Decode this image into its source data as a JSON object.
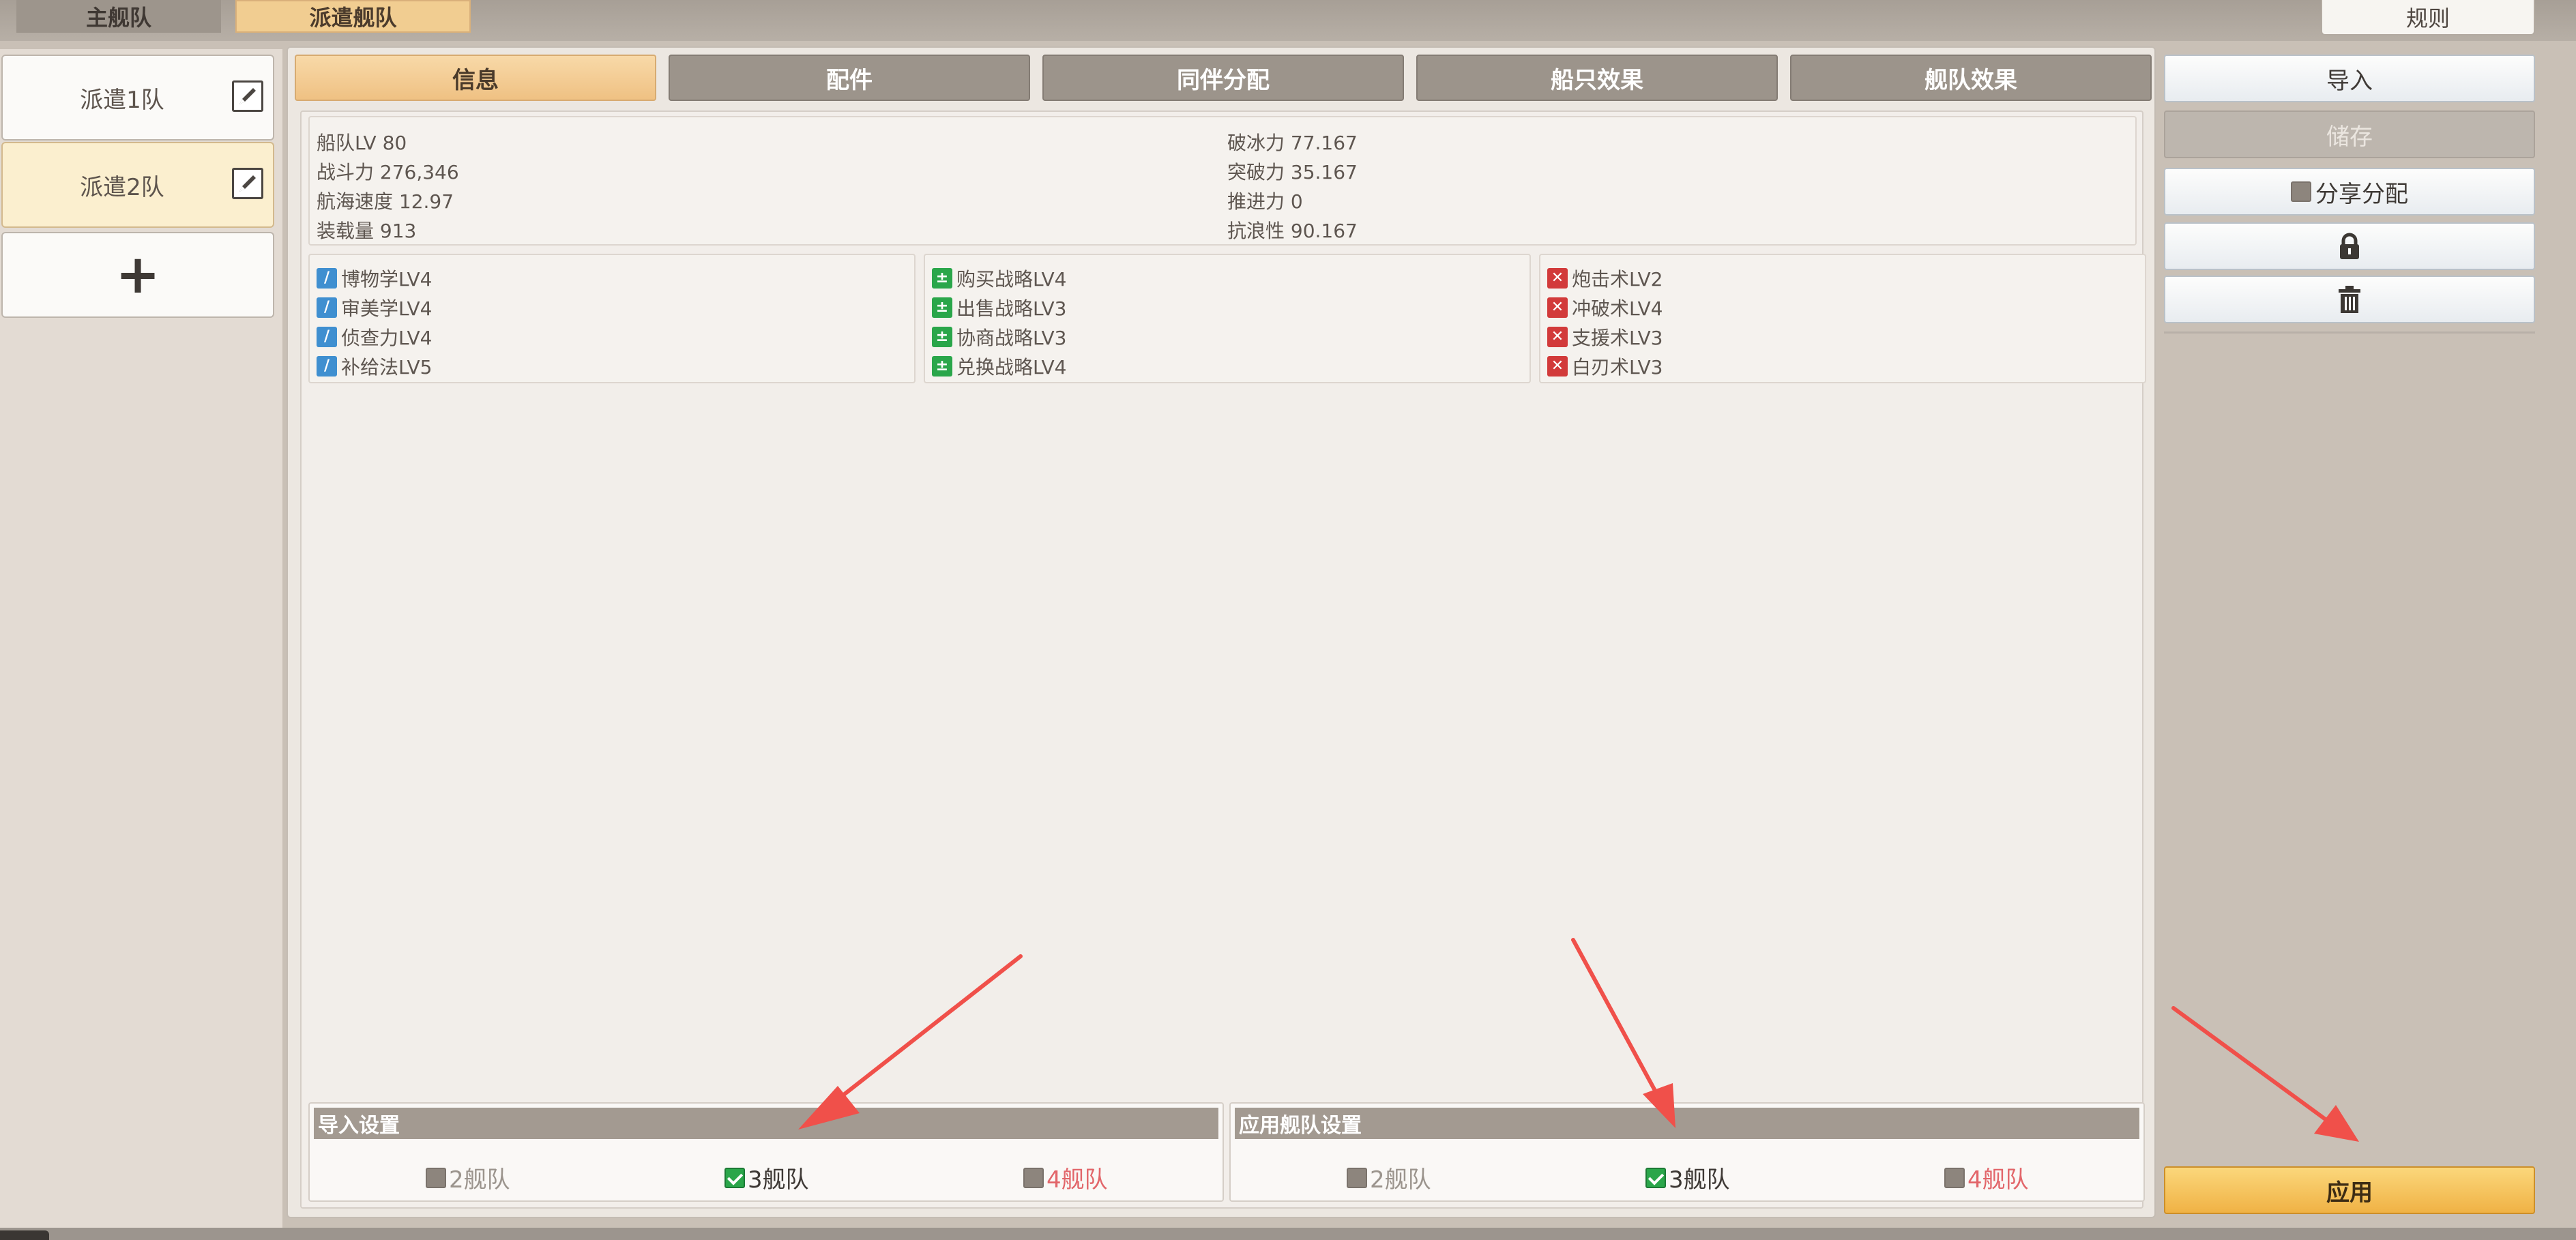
{
  "top_tabs": {
    "main": "主舰队",
    "dispatch": "派遣舰队"
  },
  "rule_button": "规则",
  "teams": [
    {
      "label": "派遣1队"
    },
    {
      "label": "派遣2队"
    }
  ],
  "tabs": [
    "信息",
    "配件",
    "同伴分配",
    "船只效果",
    "舰队效果"
  ],
  "stats": {
    "left": [
      "船队LV 80",
      "战斗力 276,346",
      "航海速度 12.97",
      "装载量 913"
    ],
    "right": [
      "破冰力 77.167",
      "突破力 35.167",
      "推进力 0",
      "抗浪性 90.167"
    ]
  },
  "skills": {
    "col1": [
      "博物学LV4",
      "审美学LV4",
      "侦查力LV4",
      "补给法LV5"
    ],
    "col2": [
      "购买战略LV4",
      "出售战略LV3",
      "协商战略LV3",
      "兑换战略LV4"
    ],
    "col3": [
      "炮击术LV2",
      "冲破术LV4",
      "支援术LV3",
      "白刃术LV3"
    ]
  },
  "icons": {
    "col1": "pen-skill-icon",
    "col2": "trade-skill-icon",
    "col3": "battle-skill-icon"
  },
  "import_settings": {
    "title": "导入设置",
    "options": [
      {
        "label": "2舰队",
        "checked": false
      },
      {
        "label": "3舰队",
        "checked": true
      },
      {
        "label": "4舰队",
        "checked": false
      }
    ]
  },
  "apply_settings": {
    "title": "应用舰队设置",
    "options": [
      {
        "label": "2舰队",
        "checked": false
      },
      {
        "label": "3舰队",
        "checked": true
      },
      {
        "label": "4舰队",
        "checked": false
      }
    ]
  },
  "right_panel": {
    "import": "导入",
    "save": "储存",
    "share": "分享分配",
    "apply": "应用"
  },
  "colors": {
    "active_tab": "#efc183",
    "apply_button": "#f0b245",
    "annotation_arrow": "#f0504a"
  }
}
